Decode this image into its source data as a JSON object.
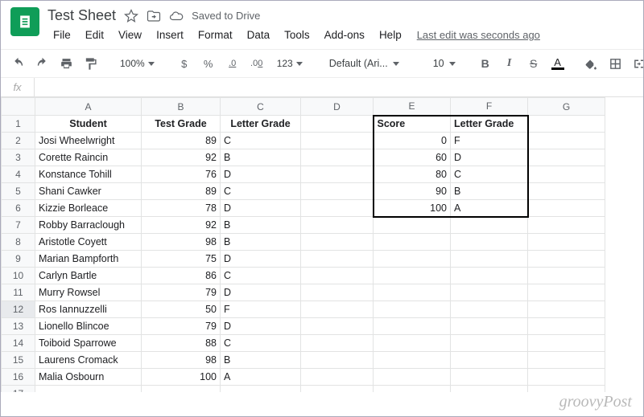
{
  "doc": {
    "title": "Test Sheet",
    "saved": "Saved to Drive",
    "last_edit": "Last edit was seconds ago"
  },
  "menu": {
    "file": "File",
    "edit": "Edit",
    "view": "View",
    "insert": "Insert",
    "format": "Format",
    "data": "Data",
    "tools": "Tools",
    "addons": "Add-ons",
    "help": "Help"
  },
  "toolbar": {
    "zoom": "100%",
    "currency": "$",
    "percent": "%",
    "dec_dec": ".0",
    "dec_inc": ".00",
    "more_fmt": "123",
    "font": "Default (Ari...",
    "size": "10",
    "bold": "B",
    "italic": "I",
    "strike": "S",
    "textcolor": "A"
  },
  "fx": {
    "label": "fx",
    "value": ""
  },
  "columns": [
    "A",
    "B",
    "C",
    "D",
    "E",
    "F",
    "G"
  ],
  "headers": {
    "A": "Student",
    "B": "Test Grade",
    "C": "Letter Grade",
    "E": "Score",
    "F": "Letter Grade"
  },
  "students": [
    {
      "name": "Josi Wheelwright",
      "grade": 89,
      "letter": "C"
    },
    {
      "name": "Corette Raincin",
      "grade": 92,
      "letter": "B"
    },
    {
      "name": "Konstance Tohill",
      "grade": 76,
      "letter": "D"
    },
    {
      "name": "Shani Cawker",
      "grade": 89,
      "letter": "C"
    },
    {
      "name": "Kizzie Borleace",
      "grade": 78,
      "letter": "D"
    },
    {
      "name": "Robby Barraclough",
      "grade": 92,
      "letter": "B"
    },
    {
      "name": "Aristotle Coyett",
      "grade": 98,
      "letter": "B"
    },
    {
      "name": "Marian Bampforth",
      "grade": 75,
      "letter": "D"
    },
    {
      "name": "Carlyn Bartle",
      "grade": 86,
      "letter": "C"
    },
    {
      "name": "Murry Rowsel",
      "grade": 79,
      "letter": "D"
    },
    {
      "name": "Ros Iannuzzelli",
      "grade": 50,
      "letter": "F"
    },
    {
      "name": "Lionello Blincoe",
      "grade": 79,
      "letter": "D"
    },
    {
      "name": "Toiboid Sparrowe",
      "grade": 88,
      "letter": "C"
    },
    {
      "name": "Laurens Cromack",
      "grade": 98,
      "letter": "B"
    },
    {
      "name": "Malia Osbourn",
      "grade": 100,
      "letter": "A"
    }
  ],
  "lookup": [
    {
      "score": 0,
      "letter": "F"
    },
    {
      "score": 60,
      "letter": "D"
    },
    {
      "score": 80,
      "letter": "C"
    },
    {
      "score": 90,
      "letter": "B"
    },
    {
      "score": 100,
      "letter": "A"
    }
  ],
  "selected_row": 12,
  "watermark": "groovyPost"
}
